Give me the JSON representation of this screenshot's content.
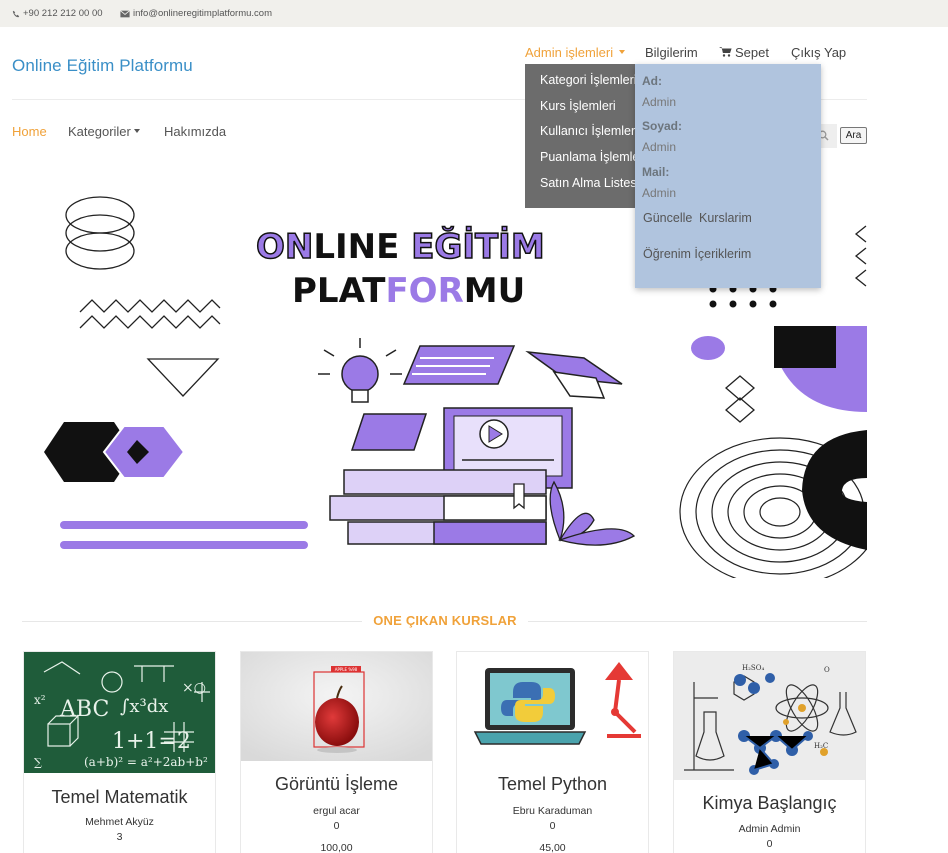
{
  "topbar": {
    "phone": "+90 212 212 00 00",
    "email": "info@onlineregitimplatformu.com"
  },
  "header": {
    "brand": "Online Eğitim Platformu",
    "admin_menu": "Admin işlemleri",
    "info": "Bilgilerim",
    "cart": "Sepet",
    "logout": "Çıkış Yap"
  },
  "nav": {
    "home": "Home",
    "categories": "Kategoriler",
    "about": "Hakımızda",
    "search_button": "Ara"
  },
  "admin_dropdown": {
    "items": [
      "Kategori İşlemleri",
      "Kurs İşlemleri",
      "Kullanıcı İşlemleri",
      "Puanlama İşlemleri",
      "Satın Alma Listesi"
    ]
  },
  "user_dropdown": {
    "name_label": "Ad:",
    "name": "Admin",
    "surname_label": "Soyad:",
    "surname": "Admin",
    "mail_label": "Mail:",
    "mail": "Admin",
    "update_link": "Güncelle",
    "courses_link": "Kurslarim",
    "content_link": "Öğrenim İçeriklerim"
  },
  "hero": {
    "line1_a": "ON",
    "line1_b": "LINE ",
    "line1_c": "EĞİTİM",
    "line2_a": "PLAT",
    "line2_b": "FOR",
    "line2_c": "MU"
  },
  "featured": {
    "title": "ONE ÇIKAN KURSLAR",
    "courses": [
      {
        "title": "Temel Matematik",
        "author": "Mehmet Akyüz",
        "count": "3",
        "price": ""
      },
      {
        "title": "Görüntü İşleme",
        "author": "ergul acar",
        "count": "0",
        "price": "100,00"
      },
      {
        "title": "Temel Python",
        "author": "Ebru Karaduman",
        "count": "0",
        "price": "45,00"
      },
      {
        "title": "Kimya Başlangıç",
        "author": "Admin Admin",
        "count": "0",
        "price": ""
      }
    ],
    "image_badge": "APPLE %98"
  },
  "colors": {
    "accent": "#f0a23a",
    "brand": "#3a8fc7",
    "purple": "#9b7ae6",
    "admin_dropdown_bg": "#6c6c6c",
    "user_dropdown_bg": "#b0c4de"
  },
  "icons": [
    "phone-icon",
    "mail-icon",
    "cart-icon",
    "search-icon",
    "caret-down-icon"
  ]
}
